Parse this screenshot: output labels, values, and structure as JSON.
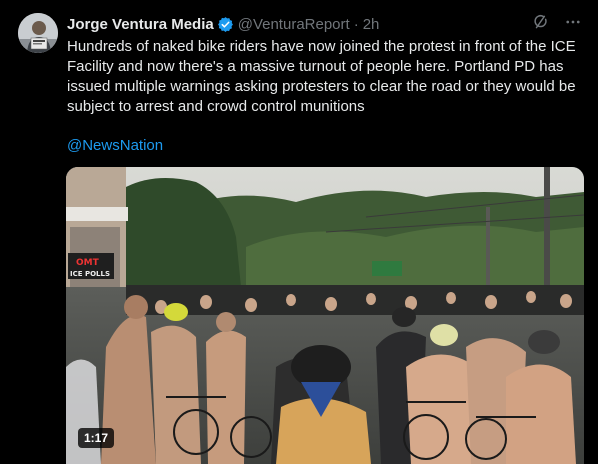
{
  "tweet": {
    "author_name": "Jorge Ventura Media",
    "handle": "@VenturaReport",
    "separator": "·",
    "time": "2h",
    "text": "Hundreds of naked bike riders have now joined the protest in front of the ICE Facility and now there's a massive turnout of people here. Portland PD has issued multiple warnings asking protesters to clear the road or they would be subject to arrest and crowd control munitions",
    "mention": "@NewsNation"
  },
  "media": {
    "duration": "1:17",
    "signs": [
      "OMT",
      "ICE POLLS"
    ]
  },
  "icons": {
    "verified": "verified-badge-icon",
    "grok": "grok-icon",
    "more": "more-icon"
  },
  "colors": {
    "background": "#000000",
    "text": "#e7e9ea",
    "secondary": "#71767b",
    "link": "#1d9bf0",
    "verified": "#1d9bf0"
  }
}
